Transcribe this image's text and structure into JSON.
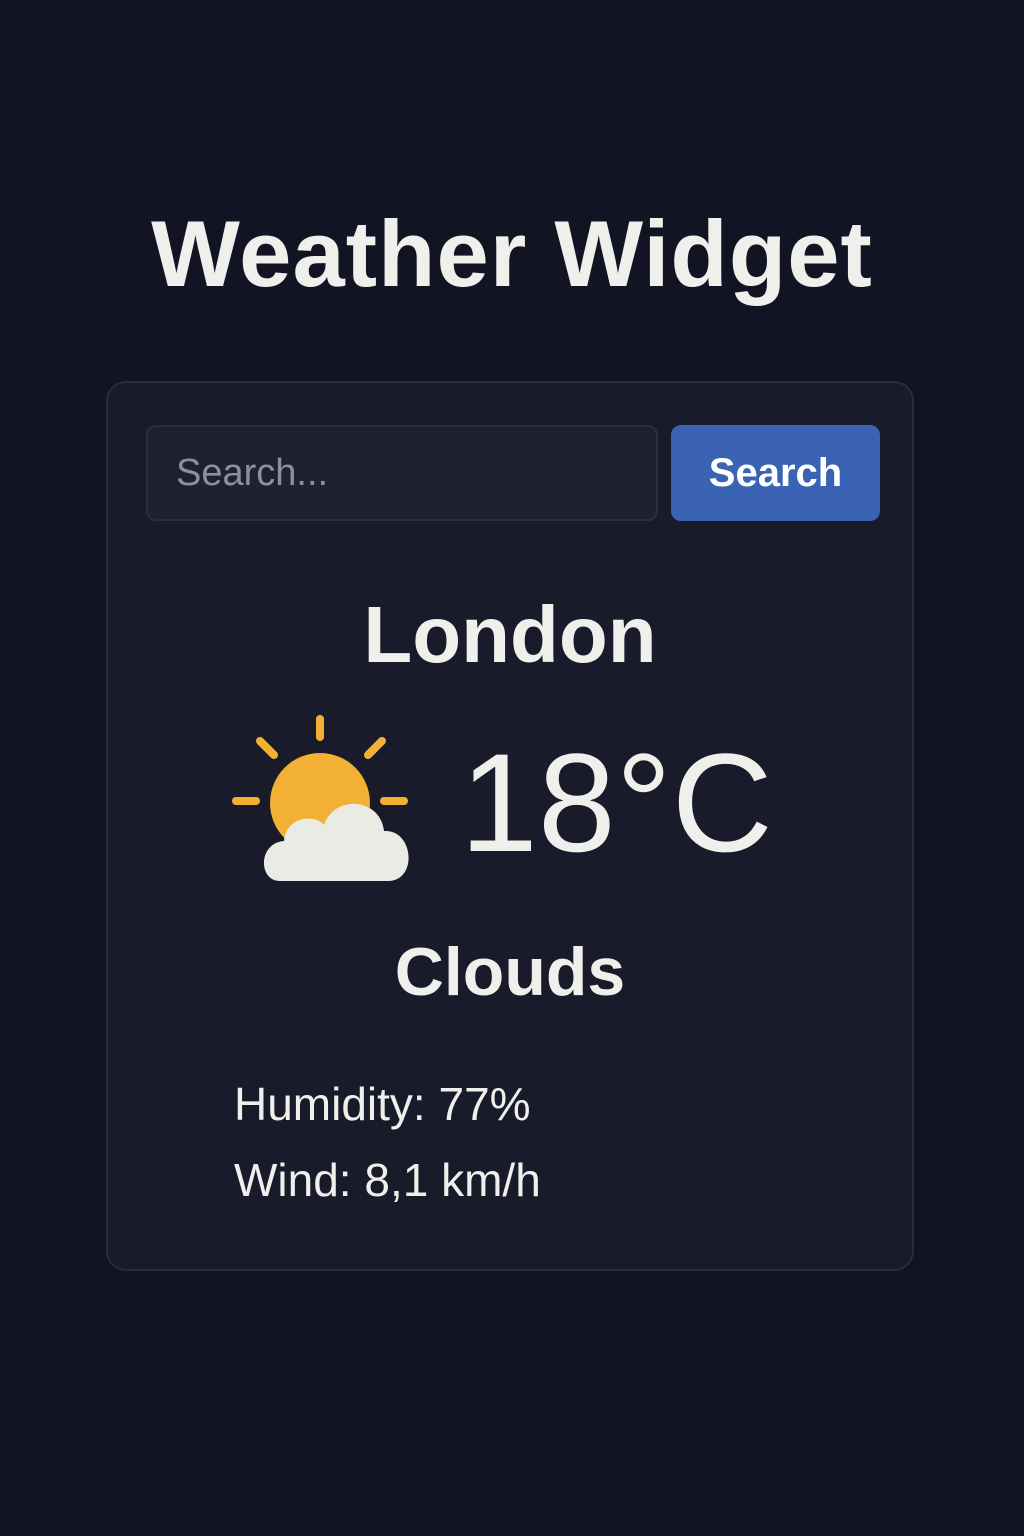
{
  "page": {
    "title": "Weather Widget"
  },
  "search": {
    "placeholder": "Search...",
    "value": "",
    "button_label": "Search"
  },
  "weather": {
    "city": "London",
    "temperature": "18°C",
    "condition": "Clouds",
    "icon": "partly-cloudy-icon",
    "humidity_text": "Humidity: 77%",
    "wind_text": "Wind: 8,1 km/h"
  },
  "colors": {
    "background": "#121424",
    "card": "#191b2a",
    "accent_button": "#3b63b3",
    "sun": "#f2b134",
    "cloud": "#ebebe6"
  }
}
